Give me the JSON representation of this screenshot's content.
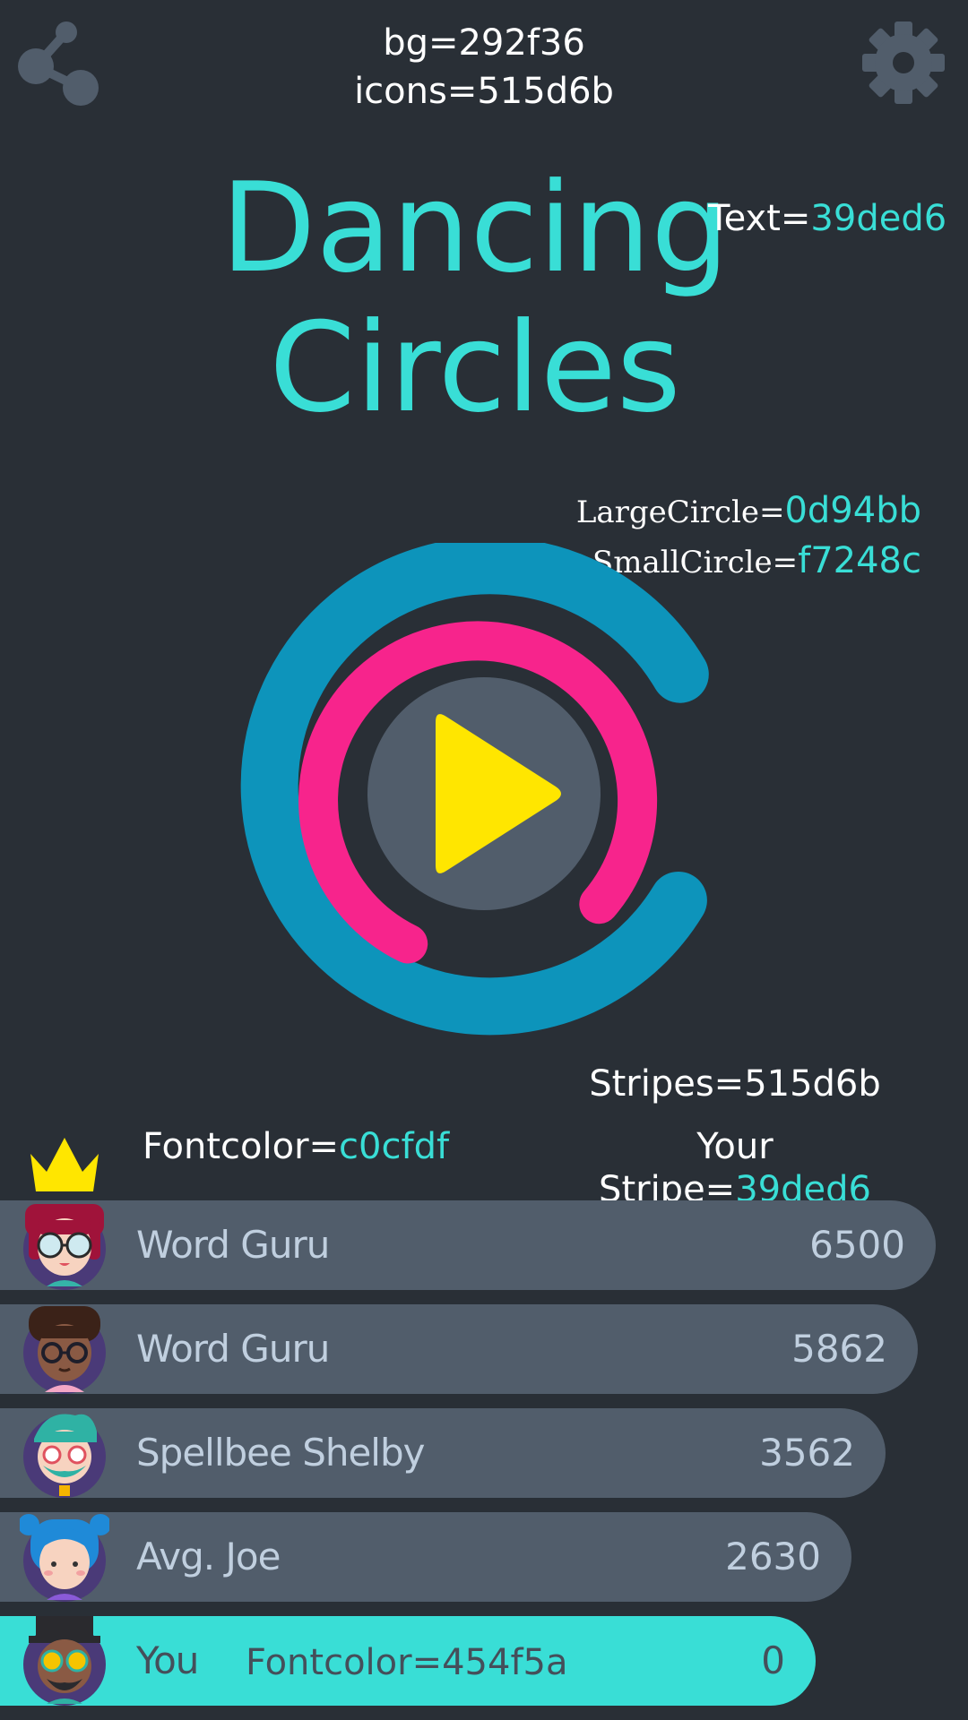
{
  "top": {
    "bg_note": "bg=292f36",
    "icons_note": "icons=515d6b"
  },
  "title": {
    "line1": "Dancing",
    "line2": "Circles"
  },
  "notes": {
    "text_label": "Text=",
    "text_value": "39ded6",
    "large_label": "LargeCircle=",
    "large_value": "0d94bb",
    "small_label": "SmallCircle=",
    "small_value": "f7248c",
    "stripes": "Stripes=515d6b",
    "fontcolor_label": "Fontcolor=",
    "fontcolor_value": "c0cfdf",
    "yourstripe_label": "Your Stripe=",
    "yourstripe_value": "39ded6"
  },
  "colors": {
    "background": "#292f36",
    "icons": "#515d6b",
    "text": "#39ded6",
    "large_circle": "#0d94bb",
    "small_circle": "#f7248c",
    "stripes": "#515d6b",
    "your_stripe": "#39ded6",
    "font": "#c0cfdf",
    "your_font": "#454f5a",
    "play": "#ffe600"
  },
  "icons": {
    "share": "share-icon",
    "settings": "gear-icon",
    "play": "play-icon",
    "crown": "crown-icon"
  },
  "leaderboard": [
    {
      "name": "Word Guru",
      "score": "6500",
      "rank": 1
    },
    {
      "name": "Word Guru",
      "score": "5862",
      "rank": 2
    },
    {
      "name": "Spellbee Shelby",
      "score": "3562",
      "rank": 3
    },
    {
      "name": "Avg. Joe",
      "score": "2630",
      "rank": 4
    },
    {
      "name": "You",
      "score": "0",
      "rank": 5,
      "note": "Fontcolor=454f5a"
    }
  ]
}
